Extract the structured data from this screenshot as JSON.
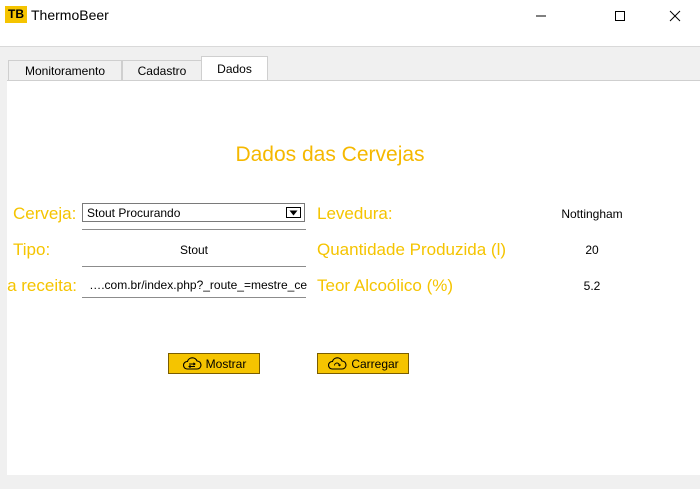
{
  "window": {
    "icon_text": "TB",
    "title": "ThermoBeer"
  },
  "tabs": [
    {
      "label": "Monitoramento",
      "active": false
    },
    {
      "label": "Cadastro",
      "active": false
    },
    {
      "label": "Dados",
      "active": true
    }
  ],
  "main": {
    "heading": "Dados das Cervejas",
    "labels": {
      "cerveja": "Cerveja:",
      "tipo": "Tipo:",
      "receita": "Link da receita:",
      "levedura": "Levedura:",
      "quantidade": "Quantidade Produzida (l)",
      "teor": "Teor Alcoólico (%)"
    },
    "values": {
      "cerveja": "Stout Procurando",
      "tipo": "Stout",
      "receita_visible": "….com.br/index.php?_route_=mestre_ce",
      "levedura": "Nottingham",
      "quantidade": "20",
      "teor": "5.2"
    },
    "buttons": {
      "mostrar": "Mostrar",
      "carregar": "Carregar"
    }
  },
  "colors": {
    "accent": "#f5c400",
    "heading": "#f5b800"
  },
  "icons": [
    "app-logo-icon",
    "minimize-icon",
    "maximize-icon",
    "close-icon",
    "dropdown-arrow-icon",
    "swap-cloud-icon",
    "cloud-upload-icon"
  ]
}
